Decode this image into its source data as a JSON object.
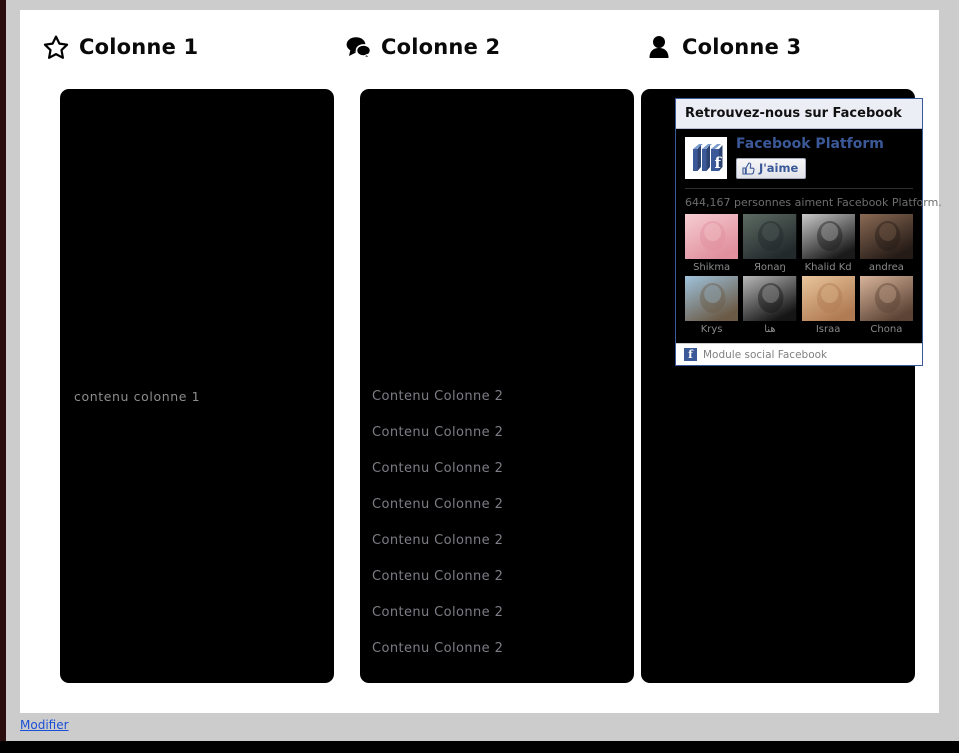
{
  "page": {
    "background_color": "#cccccc",
    "card_color": "#ffffff",
    "panel_color": "#000000",
    "edit_link": "Modifier"
  },
  "columns": [
    {
      "icon": "star-icon",
      "title": "Colonne 1",
      "items": [
        "contenu colonne 1"
      ]
    },
    {
      "icon": "comments-icon",
      "title": "Colonne 2",
      "items": [
        "Contenu Colonne 2",
        "Contenu Colonne 2",
        "Contenu Colonne 2",
        "Contenu Colonne 2",
        "Contenu Colonne 2",
        "Contenu Colonne 2",
        "Contenu Colonne 2",
        "Contenu Colonne 2"
      ]
    },
    {
      "icon": "user-icon",
      "title": "Colonne 3",
      "items": []
    }
  ],
  "facebook_widget": {
    "header": "Retrouvez-nous sur Facebook",
    "page_name": "Facebook Platform",
    "like_button": "J'aime",
    "like_icon": "thumbs-up-icon",
    "logo_icon": "facebook-platform-logo",
    "likes_text": "644,167 personnes aiment Facebook Platform.",
    "brand_color": "#3b5998",
    "faces": [
      {
        "name": "Shikma",
        "tone1": "#f6cdd2",
        "tone2": "#e08f9d"
      },
      {
        "name": "Яonaŋ",
        "tone1": "#5d6b63",
        "tone2": "#22292b"
      },
      {
        "name": "Khalid Kd",
        "tone1": "#c9c9c9",
        "tone2": "#1a1a1a"
      },
      {
        "name": "andrea",
        "tone1": "#8a6a54",
        "tone2": "#241a16"
      },
      {
        "name": "Krys",
        "tone1": "#9fc3dd",
        "tone2": "#6b5a46"
      },
      {
        "name": "هنا",
        "tone1": "#b8b8b8",
        "tone2": "#151515"
      },
      {
        "name": "Israa",
        "tone1": "#e8c59c",
        "tone2": "#b07a52"
      },
      {
        "name": "Chona",
        "tone1": "#d8b49a",
        "tone2": "#5c4335"
      }
    ],
    "footer": "Module social Facebook",
    "footer_icon": "facebook-f-icon"
  }
}
